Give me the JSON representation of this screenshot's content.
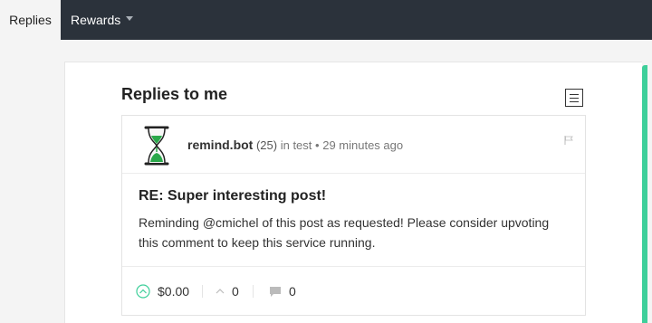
{
  "nav": {
    "tabs": [
      {
        "label": "Replies",
        "active": true
      },
      {
        "label": "Rewards",
        "active": false
      }
    ]
  },
  "main": {
    "title": "Replies to me"
  },
  "reply": {
    "author": "remind.bot",
    "reputation": "(25)",
    "category_text": "in test",
    "separator": "•",
    "time": "29 minutes ago",
    "title": "RE: Super interesting post!",
    "body": "Reminding @cmichel of this post as requested! Please consider upvoting this comment to keep this service running.",
    "payout": "$0.00",
    "votes": "0",
    "comments": "0"
  },
  "colors": {
    "topbar": "#2b323b",
    "accent": "#3ecf9a",
    "upvote": "#3ecf9a"
  }
}
